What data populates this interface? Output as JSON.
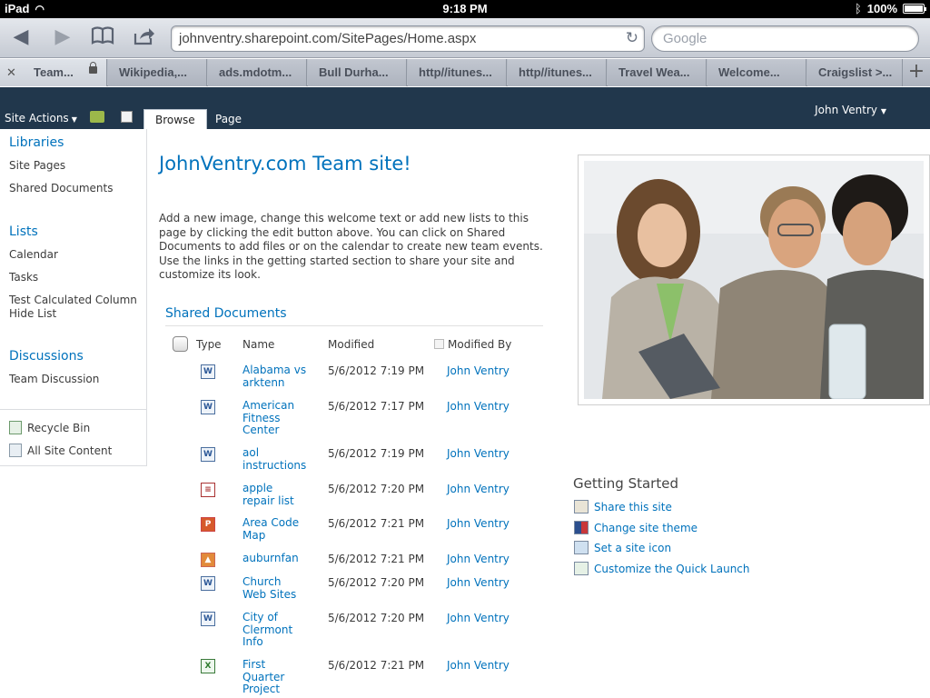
{
  "status_bar": {
    "device": "iPad",
    "time": "9:18 PM",
    "battery": "100%"
  },
  "browser": {
    "url": "johnventry.sharepoint.com/SitePages/Home.aspx",
    "search_placeholder": "Google",
    "tabs": [
      {
        "label": "Team..."
      },
      {
        "label": "Wikipedia,..."
      },
      {
        "label": "ads.mdotm..."
      },
      {
        "label": "Bull Durha..."
      },
      {
        "label": "http//itunes..."
      },
      {
        "label": "http//itunes..."
      },
      {
        "label": "Travel Wea..."
      },
      {
        "label": "Welcome..."
      },
      {
        "label": "Craigslist >..."
      }
    ]
  },
  "ribbon": {
    "site_actions": "Site Actions",
    "tab_browse": "Browse",
    "tab_page": "Page",
    "user": "John Ventry"
  },
  "leftnav": {
    "libraries": "Libraries",
    "site_pages": "Site Pages",
    "shared_documents": "Shared Documents",
    "lists": "Lists",
    "calendar": "Calendar",
    "tasks": "Tasks",
    "test_calc_1": "Test Calculated Column",
    "test_calc_2": "Hide List",
    "discussions": "Discussions",
    "team_discussion": "Team Discussion",
    "recycle_bin": "Recycle Bin",
    "all_site_content": "All Site Content"
  },
  "main": {
    "title": "JohnVentry.com Team site!",
    "welcome": "Add a new image, change this welcome text or add new lists to this page by clicking the edit button above. You can click on Shared Documents to add files or on the calendar to create new team events. Use the links in the getting started section to share your site and customize its look."
  },
  "documents": {
    "heading": "Shared Documents",
    "columns": {
      "type": "Type",
      "name": "Name",
      "modified": "Modified",
      "modified_by": "Modified By"
    },
    "rows": [
      {
        "icon": "word-doc-icon",
        "icon_text": "W",
        "name_1": "Alabama vs",
        "name_2": "arktenn",
        "name_3": "",
        "modified": "5/6/2012 7:19 PM",
        "by": "John Ventry"
      },
      {
        "icon": "word-doc-icon",
        "icon_text": "W",
        "name_1": "American",
        "name_2": "Fitness",
        "name_3": "Center",
        "modified": "5/6/2012 7:17 PM",
        "by": "John Ventry"
      },
      {
        "icon": "word-doc-icon",
        "icon_text": "W",
        "name_1": "aol",
        "name_2": "instructions",
        "name_3": "",
        "modified": "5/6/2012 7:19 PM",
        "by": "John Ventry"
      },
      {
        "icon": "text-doc-icon",
        "icon_text": "≡",
        "name_1": "apple",
        "name_2": "repair list",
        "name_3": "",
        "modified": "5/6/2012 7:20 PM",
        "by": "John Ventry"
      },
      {
        "icon": "pdf-doc-icon",
        "icon_text": "P",
        "name_1": "Area Code",
        "name_2": "Map",
        "name_3": "",
        "modified": "5/6/2012 7:21 PM",
        "by": "John Ventry"
      },
      {
        "icon": "image-doc-icon",
        "icon_text": "▲",
        "name_1": "auburnfan",
        "name_2": "",
        "name_3": "",
        "modified": "5/6/2012 7:21 PM",
        "by": "John Ventry"
      },
      {
        "icon": "word-doc-icon",
        "icon_text": "W",
        "name_1": "Church",
        "name_2": "Web Sites",
        "name_3": "",
        "modified": "5/6/2012 7:20 PM",
        "by": "John Ventry"
      },
      {
        "icon": "word-doc-icon",
        "icon_text": "W",
        "name_1": "City of",
        "name_2": "Clermont",
        "name_3": "Info",
        "modified": "5/6/2012 7:20 PM",
        "by": "John Ventry"
      },
      {
        "icon": "excel-doc-icon",
        "icon_text": "X",
        "name_1": "First",
        "name_2": "Quarter",
        "name_3": "Project",
        "modified": "5/6/2012 7:21 PM",
        "by": "John Ventry"
      }
    ]
  },
  "getting_started": {
    "title": "Getting Started",
    "share": "Share this site",
    "theme": "Change site theme",
    "icon": "Set a site icon",
    "quick_launch": "Customize the Quick Launch"
  }
}
